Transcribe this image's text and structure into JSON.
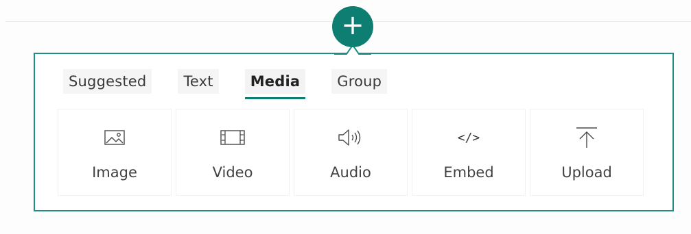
{
  "add_button": {
    "label": "+"
  },
  "tabs": [
    {
      "label": "Suggested",
      "active": false
    },
    {
      "label": "Text",
      "active": false
    },
    {
      "label": "Media",
      "active": true
    },
    {
      "label": "Group",
      "active": false
    }
  ],
  "tiles": [
    {
      "label": "Image",
      "icon": "image-icon"
    },
    {
      "label": "Video",
      "icon": "video-icon"
    },
    {
      "label": "Audio",
      "icon": "audio-icon"
    },
    {
      "label": "Embed",
      "icon": "embed-icon",
      "glyph": "</>"
    },
    {
      "label": "Upload",
      "icon": "upload-icon"
    }
  ],
  "colors": {
    "accent": "#0e7e72",
    "panel_border": "#1f8f82",
    "text": "#424242"
  }
}
